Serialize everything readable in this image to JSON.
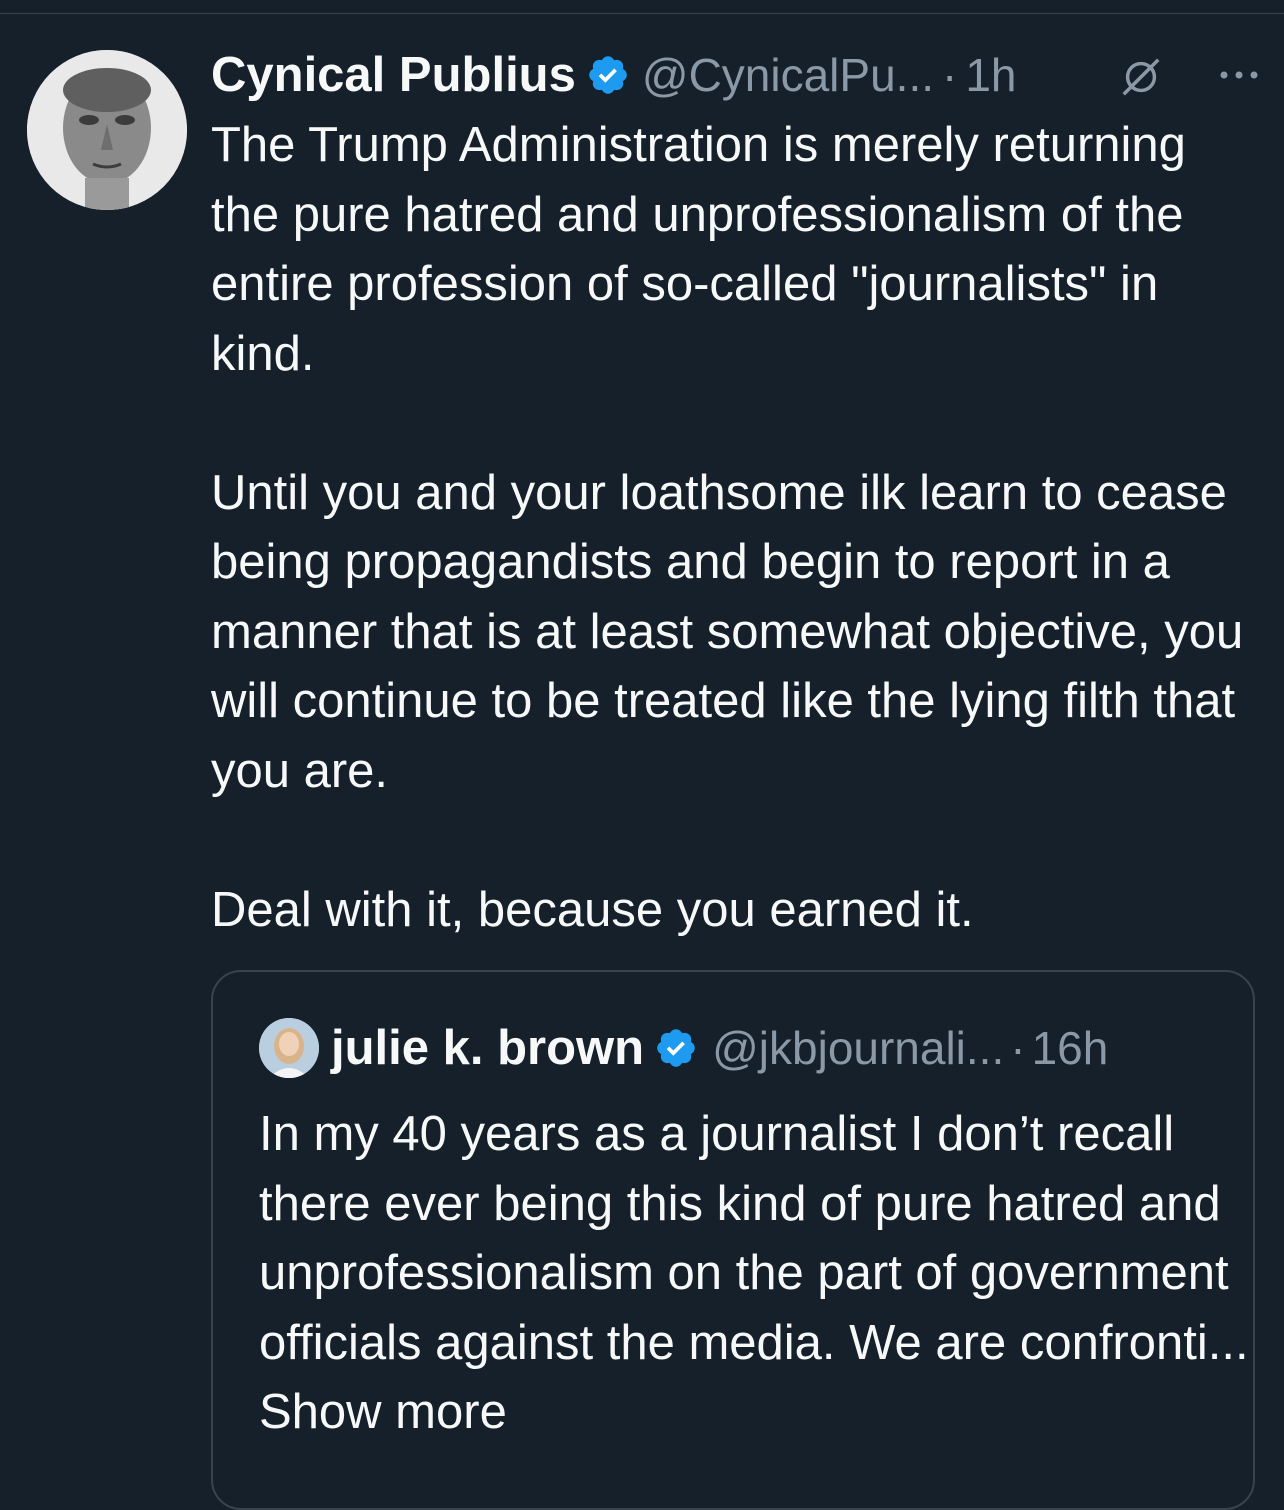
{
  "tweet": {
    "author_name": "Cynical Publius",
    "handle": "@CynicalPu...",
    "separator": "·",
    "time": "1h",
    "paragraphs": [
      "The Trump Administration is merely returning the pure hatred and unprofessionalism of the entire profession of so-called \"journalists\" in kind.",
      "Until you and your loathsome ilk learn to cease being propagandists and begin to report in a manner that is at least somewhat objective, you will continue to be treated like the lying filth that you are.",
      "Deal with it, because you earned it."
    ],
    "icons": {
      "verified": "verified-badge-icon",
      "grok": "grok-icon",
      "more": "more-options-icon"
    }
  },
  "quoted_tweet": {
    "author_name": "julie k. brown",
    "handle": "@jkbjournali...",
    "separator": "·",
    "time": "16h",
    "text": "In my 40 years as a journalist I don’t recall there ever being this kind of pure hatred and unprofessionalism on the part of government officials against the media. We are confronti...",
    "show_more": "Show more"
  },
  "colors": {
    "background": "#15202b",
    "text": "#f7f9f9",
    "secondary": "#8b98a5",
    "border": "#38444d",
    "verified": "#1d9bf0"
  }
}
